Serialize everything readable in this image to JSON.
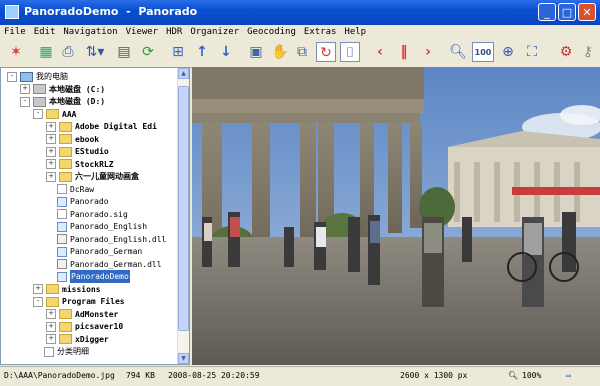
{
  "window": {
    "title": "PanoradoDemo  -  Panorado",
    "buttons": [
      "_",
      "□",
      "✕"
    ]
  },
  "menu": [
    "File",
    "Edit",
    "Navigation",
    "Viewer",
    "HDR",
    "Organizer",
    "Geocoding",
    "Extras",
    "Help"
  ],
  "toolbar": {
    "icons": [
      "new-icon",
      "gallery-icon",
      "print-icon",
      "sort-icon",
      "properties-icon",
      "refresh-icon",
      "stitch-icon",
      "up-arrow-icon",
      "down-arrow-icon",
      "view-icon",
      "hand-icon",
      "zoom-region-icon",
      "rotate-icon",
      "fit-panorama-icon",
      "previous-icon",
      "pause-icon",
      "next-icon",
      "zoom-out-icon",
      "zoom-100-icon",
      "zoom-in-icon",
      "fullscreen-icon",
      "network-icon",
      "key-icon"
    ],
    "zoom_label": "100",
    "zoom_in_symbol": "+",
    "zoom_out_symbol": "-"
  },
  "tree": {
    "items": [
      {
        "label": "我的电脑",
        "level": 0,
        "expander": "-",
        "icon": "pc",
        "bold": false
      },
      {
        "label": "本地磁盘 (C:)",
        "level": 1,
        "expander": "+",
        "icon": "drive",
        "bold": true
      },
      {
        "label": "本地磁盘 (D:)",
        "level": 1,
        "expander": "-",
        "icon": "drive",
        "bold": true
      },
      {
        "label": "AAA",
        "level": 2,
        "expander": "-",
        "icon": "folder",
        "bold": true
      },
      {
        "label": "Adobe Digital Edi",
        "level": 3,
        "expander": "+",
        "icon": "folder",
        "bold": true
      },
      {
        "label": "ebook",
        "level": 3,
        "expander": "+",
        "icon": "folder",
        "bold": true
      },
      {
        "label": "EStudio",
        "level": 3,
        "expander": "+",
        "icon": "folder",
        "bold": true
      },
      {
        "label": "StockRLZ",
        "level": 3,
        "expander": "+",
        "icon": "folder",
        "bold": true
      },
      {
        "label": "六一儿童网动画盒",
        "level": 3,
        "expander": "+",
        "icon": "folder",
        "bold": true
      },
      {
        "label": "DcRaw",
        "level": 3,
        "expander": "",
        "icon": "file",
        "bold": false
      },
      {
        "label": "Panorado",
        "level": 3,
        "expander": "",
        "icon": "fileapp",
        "bold": false
      },
      {
        "label": "Panorado.sig",
        "level": 3,
        "expander": "",
        "icon": "file",
        "bold": false
      },
      {
        "label": "Panorado_English",
        "level": 3,
        "expander": "",
        "icon": "fileapp",
        "bold": false
      },
      {
        "label": "Panorado_English.dll",
        "level": 3,
        "expander": "",
        "icon": "filedll",
        "bold": false
      },
      {
        "label": "Panorado_German",
        "level": 3,
        "expander": "",
        "icon": "fileapp",
        "bold": false
      },
      {
        "label": "Panorado_German.dll",
        "level": 3,
        "expander": "",
        "icon": "filedll",
        "bold": false
      },
      {
        "label": "PanoradoDemo",
        "level": 3,
        "expander": "",
        "icon": "fileapp",
        "bold": false,
        "selected": true
      },
      {
        "label": "missions",
        "level": 2,
        "expander": "+",
        "icon": "folder",
        "bold": true
      },
      {
        "label": "Program Files",
        "level": 2,
        "expander": "-",
        "icon": "folder",
        "bold": true
      },
      {
        "label": "AdMonster",
        "level": 3,
        "expander": "+",
        "icon": "folder",
        "bold": true
      },
      {
        "label": "picsaver10",
        "level": 3,
        "expander": "+",
        "icon": "folder",
        "bold": true
      },
      {
        "label": "xDigger",
        "level": 3,
        "expander": "+",
        "icon": "folder",
        "bold": true
      },
      {
        "label": "分类明细",
        "level": 2,
        "expander": "",
        "icon": "file",
        "bold": false
      }
    ]
  },
  "status": {
    "path": "D:\\AAA\\PanoradoDemo.jpg",
    "size": "794 KB",
    "datetime": "2008-08-25 20:20:59",
    "dimensions": "2600 x 1300 px",
    "zoom": "100%"
  }
}
